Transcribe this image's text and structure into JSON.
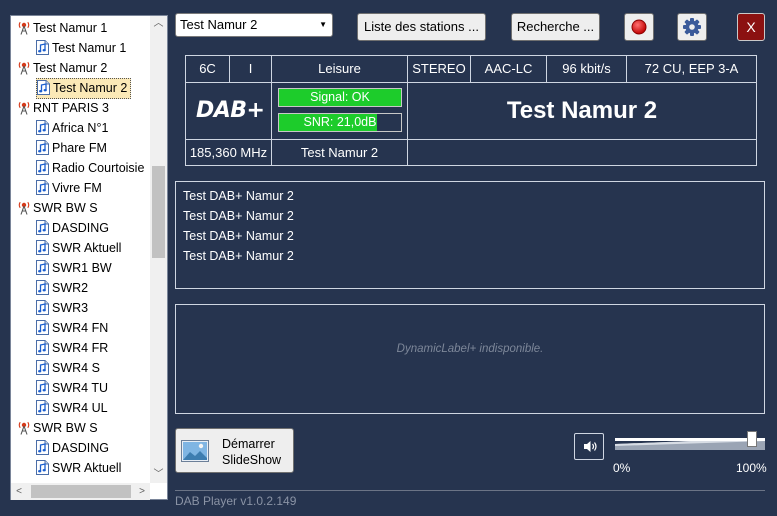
{
  "tree": {
    "items": [
      {
        "label": "Test Namur 1",
        "type": "station",
        "level": 0
      },
      {
        "label": "Test Namur 1",
        "type": "service",
        "level": 1
      },
      {
        "label": "Test Namur 2",
        "type": "station",
        "level": 0
      },
      {
        "label": "Test Namur 2",
        "type": "service",
        "level": 1,
        "selected": true
      },
      {
        "label": "RNT PARIS 3",
        "type": "station",
        "level": 0
      },
      {
        "label": "Africa N°1",
        "type": "service",
        "level": 1
      },
      {
        "label": "Phare FM",
        "type": "service",
        "level": 1
      },
      {
        "label": "Radio Courtoisie",
        "type": "service",
        "level": 1
      },
      {
        "label": "Vivre FM",
        "type": "service",
        "level": 1
      },
      {
        "label": "SWR BW S",
        "type": "station",
        "level": 0
      },
      {
        "label": "DASDING",
        "type": "service",
        "level": 1
      },
      {
        "label": "SWR Aktuell",
        "type": "service",
        "level": 1
      },
      {
        "label": "SWR1 BW",
        "type": "service",
        "level": 1
      },
      {
        "label": "SWR2",
        "type": "service",
        "level": 1
      },
      {
        "label": "SWR3",
        "type": "service",
        "level": 1
      },
      {
        "label": "SWR4 FN",
        "type": "service",
        "level": 1
      },
      {
        "label": "SWR4 FR",
        "type": "service",
        "level": 1
      },
      {
        "label": "SWR4 S",
        "type": "service",
        "level": 1
      },
      {
        "label": "SWR4 TU",
        "type": "service",
        "level": 1
      },
      {
        "label": "SWR4 UL",
        "type": "service",
        "level": 1
      },
      {
        "label": "SWR BW S",
        "type": "station",
        "level": 0
      },
      {
        "label": "DASDING",
        "type": "service",
        "level": 1
      },
      {
        "label": "SWR Aktuell",
        "type": "service",
        "level": 1
      }
    ]
  },
  "toolbar": {
    "station_select": "Test Namur 2",
    "stations_list_label": "Liste des stations ...",
    "search_label": "Recherche ...",
    "close_label": "X",
    "record_icon": "record-icon",
    "settings_icon": "gear-icon"
  },
  "info": {
    "channel": "6C",
    "ps": "I",
    "genre": "Leisure",
    "mode": "STEREO",
    "codec": "AAC-LC",
    "bitrate": "96 kbit/s",
    "protection": "72 CU, EEP 3-A",
    "logo": "DAB+",
    "signal_text": "Signal: OK",
    "signal_level": 1.0,
    "snr_text": "SNR: 21,0dB",
    "snr_level": 0.8,
    "station_name": "Test Namur 2",
    "frequency": "185,360 MHz",
    "ensemble": "Test Namur 2"
  },
  "radiotext": {
    "lines": [
      "Test DAB+ Namur 2",
      "Test DAB+ Namur 2",
      "Test DAB+ Namur 2",
      "Test DAB+ Namur 2"
    ]
  },
  "dynamic_label": {
    "placeholder": "DynamicLabel+ indisponible."
  },
  "slideshow": {
    "line1": "Démarrer",
    "line2": "SlideShow"
  },
  "volume": {
    "min_label": "0%",
    "max_label": "100%",
    "level": 1.0
  },
  "footer": {
    "version": "DAB Player v1.0.2.149"
  },
  "colors": {
    "background": "#26344f",
    "signal_green": "#1dcc2b",
    "record_red": "#dd0000",
    "close_red": "#8b1111"
  }
}
